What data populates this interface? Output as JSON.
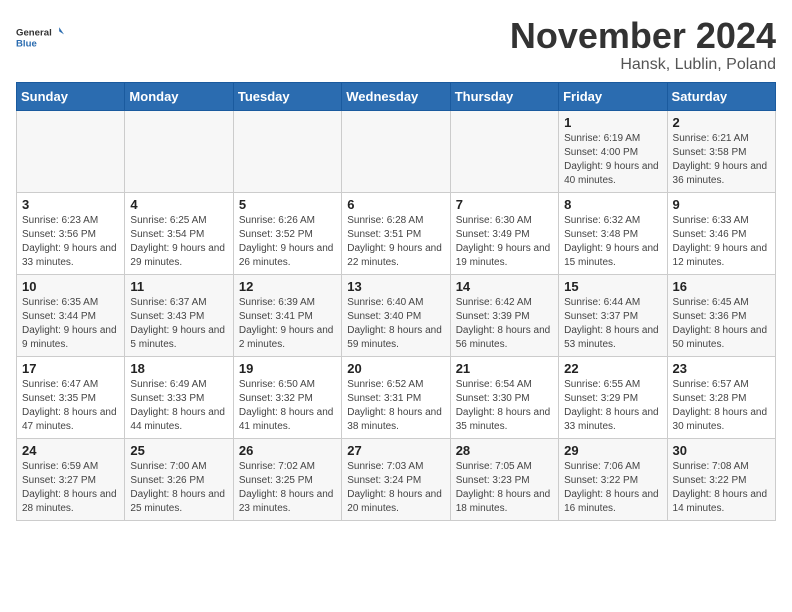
{
  "header": {
    "logo_line1": "General",
    "logo_line2": "Blue",
    "month": "November 2024",
    "location": "Hansk, Lublin, Poland"
  },
  "days_of_week": [
    "Sunday",
    "Monday",
    "Tuesday",
    "Wednesday",
    "Thursday",
    "Friday",
    "Saturday"
  ],
  "weeks": [
    [
      {
        "day": "",
        "info": ""
      },
      {
        "day": "",
        "info": ""
      },
      {
        "day": "",
        "info": ""
      },
      {
        "day": "",
        "info": ""
      },
      {
        "day": "",
        "info": ""
      },
      {
        "day": "1",
        "info": "Sunrise: 6:19 AM\nSunset: 4:00 PM\nDaylight: 9 hours and 40 minutes."
      },
      {
        "day": "2",
        "info": "Sunrise: 6:21 AM\nSunset: 3:58 PM\nDaylight: 9 hours and 36 minutes."
      }
    ],
    [
      {
        "day": "3",
        "info": "Sunrise: 6:23 AM\nSunset: 3:56 PM\nDaylight: 9 hours and 33 minutes."
      },
      {
        "day": "4",
        "info": "Sunrise: 6:25 AM\nSunset: 3:54 PM\nDaylight: 9 hours and 29 minutes."
      },
      {
        "day": "5",
        "info": "Sunrise: 6:26 AM\nSunset: 3:52 PM\nDaylight: 9 hours and 26 minutes."
      },
      {
        "day": "6",
        "info": "Sunrise: 6:28 AM\nSunset: 3:51 PM\nDaylight: 9 hours and 22 minutes."
      },
      {
        "day": "7",
        "info": "Sunrise: 6:30 AM\nSunset: 3:49 PM\nDaylight: 9 hours and 19 minutes."
      },
      {
        "day": "8",
        "info": "Sunrise: 6:32 AM\nSunset: 3:48 PM\nDaylight: 9 hours and 15 minutes."
      },
      {
        "day": "9",
        "info": "Sunrise: 6:33 AM\nSunset: 3:46 PM\nDaylight: 9 hours and 12 minutes."
      }
    ],
    [
      {
        "day": "10",
        "info": "Sunrise: 6:35 AM\nSunset: 3:44 PM\nDaylight: 9 hours and 9 minutes."
      },
      {
        "day": "11",
        "info": "Sunrise: 6:37 AM\nSunset: 3:43 PM\nDaylight: 9 hours and 5 minutes."
      },
      {
        "day": "12",
        "info": "Sunrise: 6:39 AM\nSunset: 3:41 PM\nDaylight: 9 hours and 2 minutes."
      },
      {
        "day": "13",
        "info": "Sunrise: 6:40 AM\nSunset: 3:40 PM\nDaylight: 8 hours and 59 minutes."
      },
      {
        "day": "14",
        "info": "Sunrise: 6:42 AM\nSunset: 3:39 PM\nDaylight: 8 hours and 56 minutes."
      },
      {
        "day": "15",
        "info": "Sunrise: 6:44 AM\nSunset: 3:37 PM\nDaylight: 8 hours and 53 minutes."
      },
      {
        "day": "16",
        "info": "Sunrise: 6:45 AM\nSunset: 3:36 PM\nDaylight: 8 hours and 50 minutes."
      }
    ],
    [
      {
        "day": "17",
        "info": "Sunrise: 6:47 AM\nSunset: 3:35 PM\nDaylight: 8 hours and 47 minutes."
      },
      {
        "day": "18",
        "info": "Sunrise: 6:49 AM\nSunset: 3:33 PM\nDaylight: 8 hours and 44 minutes."
      },
      {
        "day": "19",
        "info": "Sunrise: 6:50 AM\nSunset: 3:32 PM\nDaylight: 8 hours and 41 minutes."
      },
      {
        "day": "20",
        "info": "Sunrise: 6:52 AM\nSunset: 3:31 PM\nDaylight: 8 hours and 38 minutes."
      },
      {
        "day": "21",
        "info": "Sunrise: 6:54 AM\nSunset: 3:30 PM\nDaylight: 8 hours and 35 minutes."
      },
      {
        "day": "22",
        "info": "Sunrise: 6:55 AM\nSunset: 3:29 PM\nDaylight: 8 hours and 33 minutes."
      },
      {
        "day": "23",
        "info": "Sunrise: 6:57 AM\nSunset: 3:28 PM\nDaylight: 8 hours and 30 minutes."
      }
    ],
    [
      {
        "day": "24",
        "info": "Sunrise: 6:59 AM\nSunset: 3:27 PM\nDaylight: 8 hours and 28 minutes."
      },
      {
        "day": "25",
        "info": "Sunrise: 7:00 AM\nSunset: 3:26 PM\nDaylight: 8 hours and 25 minutes."
      },
      {
        "day": "26",
        "info": "Sunrise: 7:02 AM\nSunset: 3:25 PM\nDaylight: 8 hours and 23 minutes."
      },
      {
        "day": "27",
        "info": "Sunrise: 7:03 AM\nSunset: 3:24 PM\nDaylight: 8 hours and 20 minutes."
      },
      {
        "day": "28",
        "info": "Sunrise: 7:05 AM\nSunset: 3:23 PM\nDaylight: 8 hours and 18 minutes."
      },
      {
        "day": "29",
        "info": "Sunrise: 7:06 AM\nSunset: 3:22 PM\nDaylight: 8 hours and 16 minutes."
      },
      {
        "day": "30",
        "info": "Sunrise: 7:08 AM\nSunset: 3:22 PM\nDaylight: 8 hours and 14 minutes."
      }
    ]
  ]
}
